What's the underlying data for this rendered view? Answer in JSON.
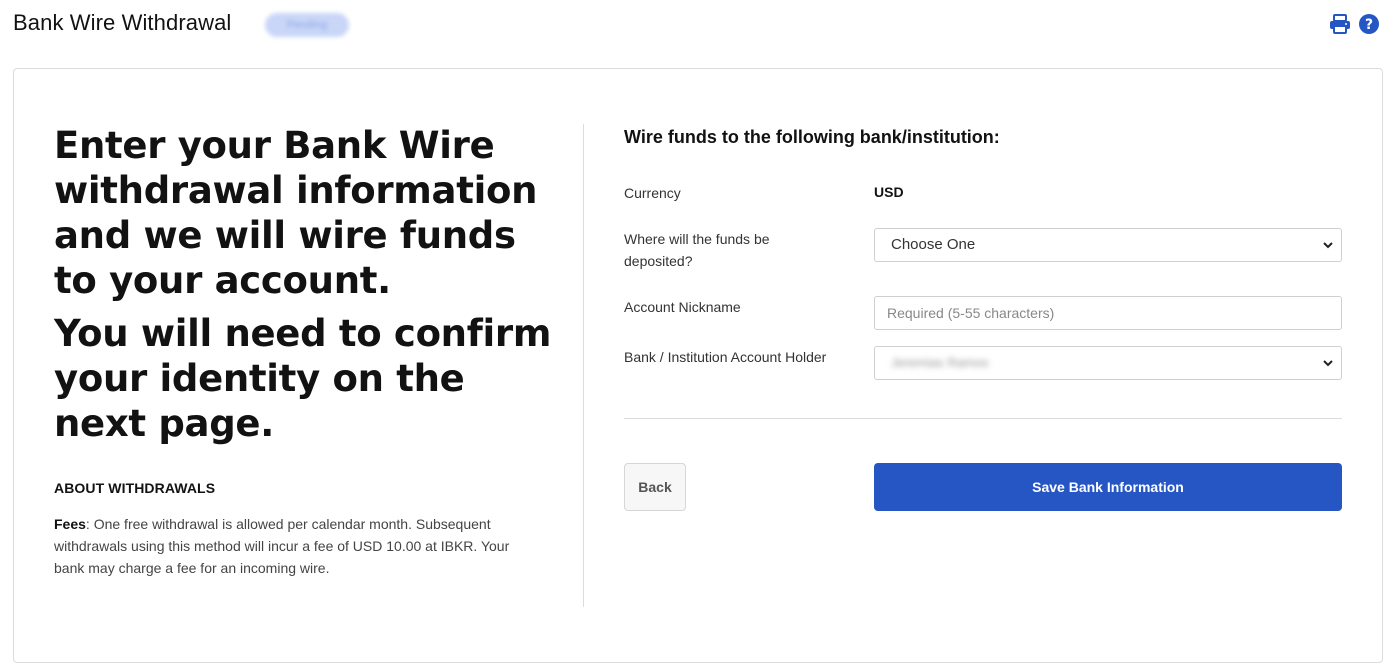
{
  "header": {
    "title": "Bank Wire Withdrawal",
    "status_badge": "Pending",
    "icons": [
      "print-icon",
      "help-icon"
    ],
    "accent_color": "#2656c4"
  },
  "left": {
    "headline_1": "Enter your Bank Wire withdrawal information and we will wire funds to your account.",
    "headline_2": "You will need to confirm your identity on the next page.",
    "about_title": "ABOUT WITHDRAWALS",
    "fees_label": "Fees",
    "fees_text": ": One free withdrawal is allowed per calendar month. Subsequent withdrawals using this method will incur a fee of USD 10.00 at IBKR. Your bank may charge a fee for an incoming wire."
  },
  "form": {
    "section_title": "Wire funds to the following bank/institution:",
    "currency_label": "Currency",
    "currency_value": "USD",
    "deposit_label": "Where will the funds be deposited?",
    "deposit_selected": "Choose One",
    "nickname_label": "Account Nickname",
    "nickname_placeholder": "Required (5-55 characters)",
    "holder_label": "Bank / Institution Account Holder",
    "holder_selected": "Jeremias Ramos"
  },
  "actions": {
    "back_label": "Back",
    "save_label": "Save Bank Information"
  }
}
